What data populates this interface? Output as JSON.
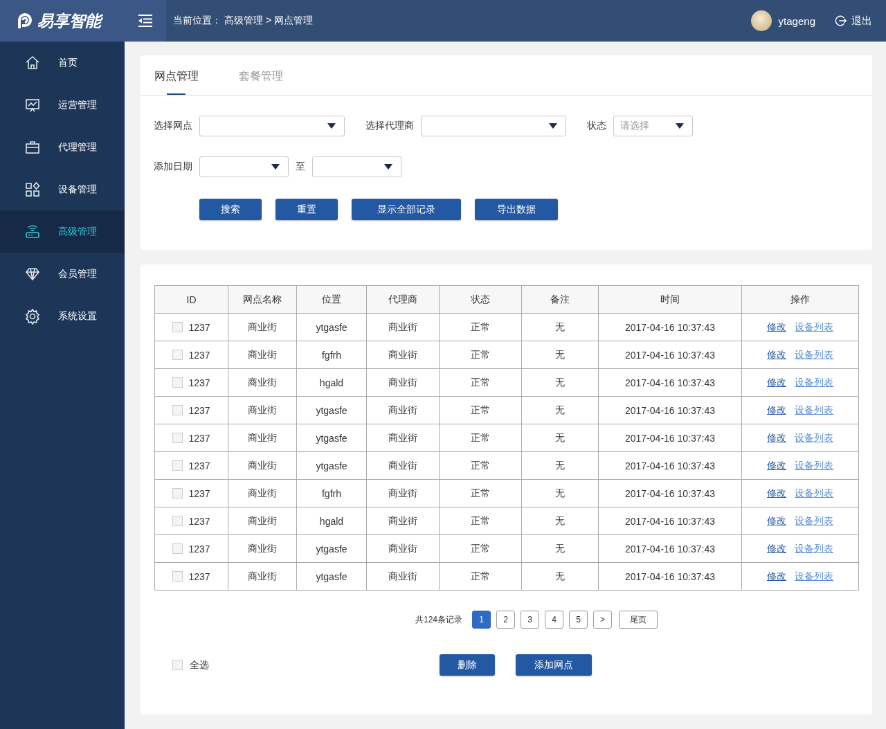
{
  "logo": {
    "text": "易享智能"
  },
  "breadcrumb": {
    "label": "当前位置：",
    "path": "高级管理 > 网点管理"
  },
  "user": {
    "name": "ytageng",
    "logout": "退出"
  },
  "sidebar": {
    "items": [
      {
        "label": "首页",
        "selected": false
      },
      {
        "label": "运营管理",
        "selected": false
      },
      {
        "label": "代理管理",
        "selected": false
      },
      {
        "label": "设备管理",
        "selected": false
      },
      {
        "label": "高级管理",
        "selected": true
      },
      {
        "label": "会员管理",
        "selected": false
      },
      {
        "label": "系统设置",
        "selected": false
      }
    ]
  },
  "tabs": [
    {
      "label": "网点管理",
      "selected": true
    },
    {
      "label": "套餐管理",
      "selected": false
    }
  ],
  "filters": {
    "row1": [
      {
        "label": "选择网点"
      },
      {
        "label": "选择代理商"
      },
      {
        "label": "状态",
        "placeholder": "请选择"
      }
    ],
    "date_label": "添加日期",
    "date_sep": "至",
    "buttons": [
      "搜索",
      "重置",
      "显示全部记录",
      "导出数据"
    ]
  },
  "table": {
    "columns": [
      "ID",
      "网点名称",
      "位置",
      "代理商",
      "状态",
      "备注",
      "时间",
      "操作"
    ],
    "rows": [
      {
        "checked": false,
        "id": "1237",
        "name": "商业街",
        "location": "ytgasfe",
        "agent": "商业街",
        "status": "正常",
        "note": "无",
        "time": "2017-04-16 10:37:43",
        "actions": [
          "修改",
          "设备列表"
        ]
      },
      {
        "checked": false,
        "id": "1237",
        "name": "商业街",
        "location": "fgfrh",
        "agent": "商业街",
        "status": "正常",
        "note": "无",
        "time": "2017-04-16 10:37:43",
        "actions": [
          "修改",
          "设备列表"
        ]
      },
      {
        "checked": false,
        "id": "1237",
        "name": "商业街",
        "location": "hgald",
        "agent": "商业街",
        "status": "正常",
        "note": "无",
        "time": "2017-04-16 10:37:43",
        "actions": [
          "修改",
          "设备列表"
        ]
      },
      {
        "checked": false,
        "id": "1237",
        "name": "商业街",
        "location": "ytgasfe",
        "agent": "商业街",
        "status": "正常",
        "note": "无",
        "time": "2017-04-16 10:37:43",
        "actions": [
          "修改",
          "设备列表"
        ]
      },
      {
        "checked": false,
        "id": "1237",
        "name": "商业街",
        "location": "ytgasfe",
        "agent": "商业街",
        "status": "正常",
        "note": "无",
        "time": "2017-04-16 10:37:43",
        "actions": [
          "修改",
          "设备列表"
        ]
      },
      {
        "checked": false,
        "id": "1237",
        "name": "商业街",
        "location": "ytgasfe",
        "agent": "商业街",
        "status": "正常",
        "note": "无",
        "time": "2017-04-16 10:37:43",
        "actions": [
          "修改",
          "设备列表"
        ]
      },
      {
        "checked": false,
        "id": "1237",
        "name": "商业街",
        "location": "fgfrh",
        "agent": "商业街",
        "status": "正常",
        "note": "无",
        "time": "2017-04-16 10:37:43",
        "actions": [
          "修改",
          "设备列表"
        ]
      },
      {
        "checked": false,
        "id": "1237",
        "name": "商业街",
        "location": "hgald",
        "agent": "商业街",
        "status": "正常",
        "note": "无",
        "time": "2017-04-16 10:37:43",
        "actions": [
          "修改",
          "设备列表"
        ]
      },
      {
        "checked": false,
        "id": "1237",
        "name": "商业街",
        "location": "ytgasfe",
        "agent": "商业街",
        "status": "正常",
        "note": "无",
        "time": "2017-04-16 10:37:43",
        "actions": [
          "修改",
          "设备列表"
        ]
      },
      {
        "checked": false,
        "id": "1237",
        "name": "商业街",
        "location": "ytgasfe",
        "agent": "商业街",
        "status": "正常",
        "note": "无",
        "time": "2017-04-16 10:37:43",
        "actions": [
          "修改",
          "设备列表"
        ]
      }
    ]
  },
  "pagination": {
    "total": "共124条记录",
    "pages": [
      {
        "label": "1",
        "selected": true
      },
      {
        "label": "2",
        "selected": false
      },
      {
        "label": "3",
        "selected": false
      },
      {
        "label": "4",
        "selected": false
      },
      {
        "label": "5",
        "selected": false
      }
    ],
    "next": ">",
    "last": "尾页"
  },
  "footer": {
    "select_all": {
      "label": "全选",
      "checked": false
    },
    "buttons": [
      "删除",
      "添加网点"
    ]
  }
}
